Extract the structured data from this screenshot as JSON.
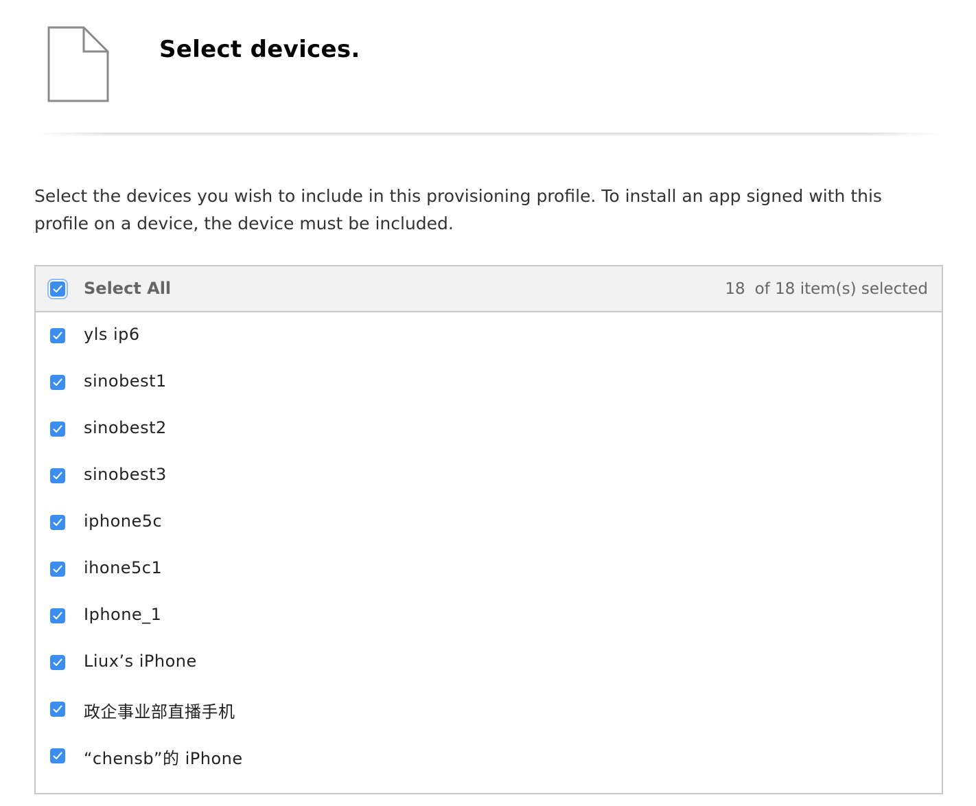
{
  "header": {
    "title": "Select devices.",
    "icon": "document-icon"
  },
  "description": "Select the devices you wish to include in this provisioning profile. To install an app signed with this profile on a device, the device must be included.",
  "table": {
    "select_all_label": "Select All",
    "select_all_checked": true,
    "selected_count": "18",
    "selected_suffix": "of 18 item(s) selected",
    "devices": [
      {
        "name": "yls ip6",
        "checked": true
      },
      {
        "name": "sinobest1",
        "checked": true
      },
      {
        "name": "sinobest2",
        "checked": true
      },
      {
        "name": "sinobest3",
        "checked": true
      },
      {
        "name": "iphone5c",
        "checked": true
      },
      {
        "name": "ihone5c1",
        "checked": true
      },
      {
        "name": "Iphone_1",
        "checked": true
      },
      {
        "name": "Liux’s iPhone",
        "checked": true
      },
      {
        "name": "政企事业部直播手机",
        "checked": true
      },
      {
        "name": "“chensb”的 iPhone",
        "checked": true
      }
    ]
  },
  "colors": {
    "checkbox": "#3b8ef0",
    "header_bg": "#f2f2f2",
    "border": "#c8c8c8",
    "title": "#000000",
    "muted_text": "#666666"
  }
}
